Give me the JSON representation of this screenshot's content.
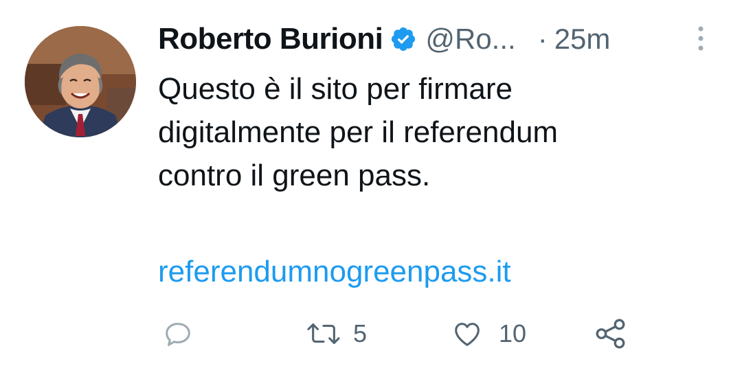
{
  "tweet": {
    "author": {
      "display_name": "Roberto Burioni",
      "handle": "@Ro...",
      "verified": true
    },
    "separator": "·",
    "time": "25m",
    "text": "Questo è il sito per firmare\ndigitalmente per il referendum\ncontro il green pass.",
    "link": "referendumnogreenpass.it",
    "actions": {
      "retweets": "5",
      "likes": "10"
    }
  },
  "colors": {
    "text": "#0f1419",
    "secondary": "#536471",
    "link": "#1d9bf0",
    "verified": "#1d9bf0",
    "icon": "#a0abb3"
  },
  "icons": {
    "reply": "reply-icon",
    "retweet": "retweet-icon",
    "like": "heart-icon",
    "share": "share-icon",
    "more": "more-options-icon",
    "verified": "verified-badge-icon"
  }
}
